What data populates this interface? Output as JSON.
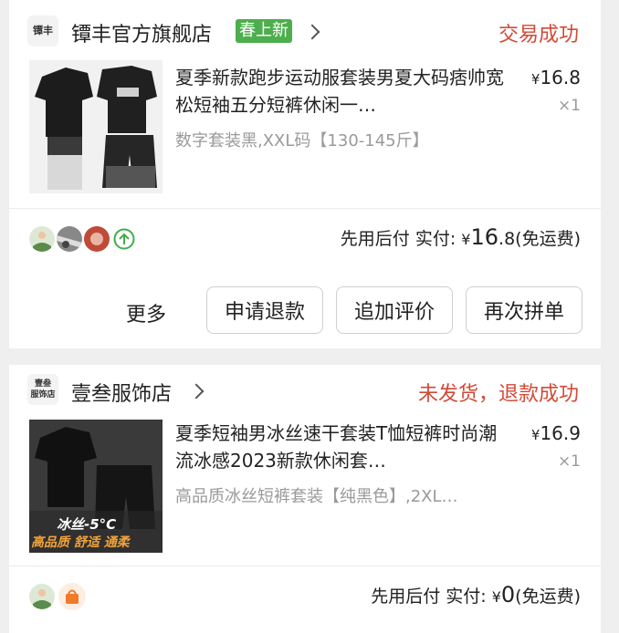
{
  "orders": [
    {
      "shop": {
        "logo_text": "镡丰",
        "name": "镡丰官方旗舰店",
        "badge": "春上新"
      },
      "status": "交易成功",
      "product": {
        "title": "夏季新款跑步运动服套装男夏大码痞帅宽松短袖五分短裤休闲一…",
        "sku": "数字套装黑,XXL码【130-145斤】",
        "currency": "¥",
        "price_int": "16",
        "price_dec": ".8",
        "qty": "×1"
      },
      "payment": {
        "label": "先用后付 实付:",
        "currency": "¥",
        "amount_int": "16",
        "amount_dec": ".8",
        "note": "(免运费)"
      },
      "actions": {
        "more": "更多",
        "refund": "申请退款",
        "review": "追加评价",
        "regroup": "再次拼单"
      }
    },
    {
      "shop": {
        "logo_text": "壹叁\n服饰店",
        "name": "壹叁服饰店"
      },
      "status": "未发货，退款成功",
      "product": {
        "title": "夏季短袖男冰丝速干套装T恤短裤时尚潮流冰感2023新款休闲套…",
        "sku": "高品质冰丝短裤套装【纯黑色】,2XL…",
        "currency": "¥",
        "price_int": "16",
        "price_dec": ".9",
        "qty": "×1",
        "image_caption": "冰丝-5°C",
        "image_tagline": "高品质 舒适 通柔"
      },
      "payment": {
        "label": "先用后付 实付:",
        "currency": "¥",
        "amount_int": "0",
        "amount_dec": "",
        "note": "(免运费)"
      }
    }
  ],
  "colors": {
    "status_red": "#d24a37",
    "badge_green": "#4cae4c",
    "sku_gray": "#9a9a9a"
  },
  "icons": [
    "chevron-right-icon",
    "arrow-up-circle-icon",
    "handbag-icon"
  ]
}
